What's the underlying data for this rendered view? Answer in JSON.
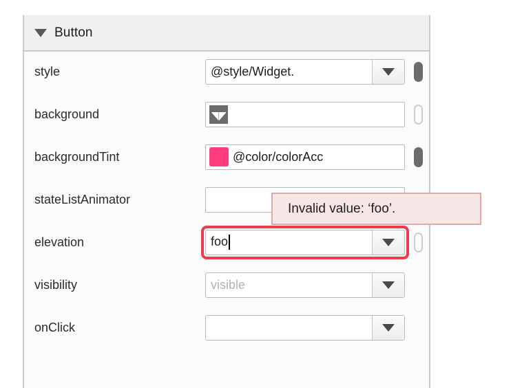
{
  "panel": {
    "section": {
      "title": "Button",
      "collapse_icon": "triangle-down-icon",
      "expanded": true
    },
    "properties": [
      {
        "name": "style",
        "label": "style",
        "value": "@style/Widget.",
        "placeholder": "",
        "has_dropdown": true,
        "indicator": "filled",
        "swatch": null,
        "glyph": null,
        "error": false
      },
      {
        "name": "background",
        "label": "background",
        "value": "",
        "placeholder": "",
        "has_dropdown": false,
        "indicator": "hollow",
        "swatch": null,
        "glyph": "image-icon",
        "error": false
      },
      {
        "name": "backgroundTint",
        "label": "backgroundTint",
        "value": "@color/colorAcc",
        "placeholder": "",
        "has_dropdown": false,
        "indicator": "filled",
        "swatch": "#FF3C80",
        "glyph": null,
        "error": false
      },
      {
        "name": "stateListAnimator",
        "label": "stateListAnimator",
        "value": "",
        "placeholder": "",
        "has_dropdown": false,
        "indicator": "none",
        "swatch": null,
        "glyph": null,
        "error": false
      },
      {
        "name": "elevation",
        "label": "elevation",
        "value": "foo",
        "placeholder": "",
        "has_dropdown": true,
        "indicator": "hollow",
        "swatch": null,
        "glyph": null,
        "error": true
      },
      {
        "name": "visibility",
        "label": "visibility",
        "value": "",
        "placeholder": "visible",
        "has_dropdown": true,
        "indicator": "none",
        "swatch": null,
        "glyph": null,
        "error": false
      },
      {
        "name": "onClick",
        "label": "onClick",
        "value": "",
        "placeholder": "",
        "has_dropdown": true,
        "indicator": "none",
        "swatch": null,
        "glyph": null,
        "error": false
      }
    ]
  },
  "tooltip": {
    "text": "Invalid value: ‘foo’.",
    "background": "#F7E6E6",
    "border": "#DCAAAA"
  },
  "colors": {
    "error_ring": "#EE3B4B",
    "accent_swatch": "#FF3C80",
    "header_bg": "#F0F0F0",
    "panel_bg": "#FBFBFB"
  }
}
